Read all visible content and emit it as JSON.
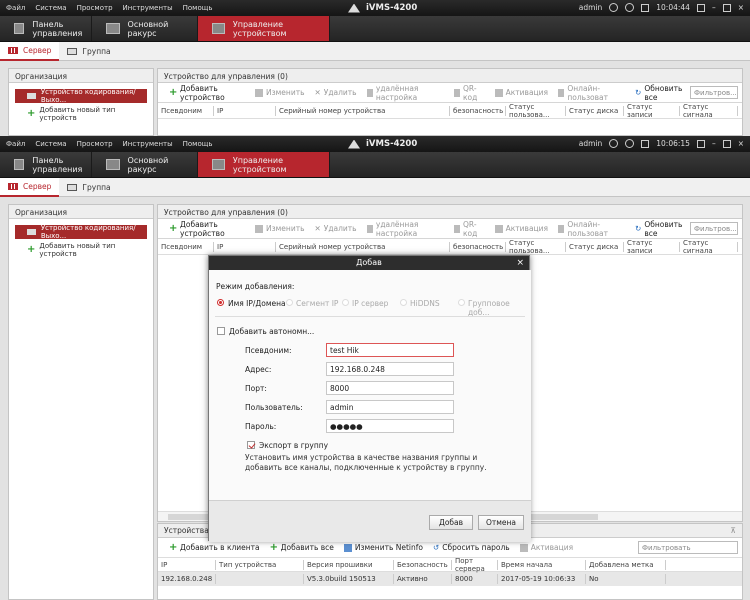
{
  "app": {
    "menu": [
      "Файл",
      "Система",
      "Просмотр",
      "Инструменты",
      "Помощь"
    ],
    "title": "iVMS-4200",
    "user": "admin",
    "nav_tabs": [
      "Панель управления",
      "Основной ракурс",
      "Управление устройством"
    ]
  },
  "window_back": {
    "time": "10:04:44"
  },
  "window_front": {
    "time": "10:06:15"
  },
  "subtabs": [
    "Сервер",
    "Группа"
  ],
  "left_panel": {
    "header": "Организация",
    "selected": "Устройство кодирования/Выхо...",
    "add_type": "Добавить новый тип устройств"
  },
  "devices_panel": {
    "header": "Устройство для управления (0)",
    "toolbar": {
      "add": "Добавить устройство",
      "modify": "Изменить",
      "delete": "Удалить",
      "remote": "удалённая настройка",
      "qr": "QR-код",
      "activate": "Активация",
      "online_user": "Онлайн-пользоват",
      "refresh": "Обновить все",
      "filter_placeholder": "Фильтров..."
    },
    "columns": [
      "Псевдоним",
      "IP",
      "Серийный номер устройства",
      "безопасность",
      "Статус пользова...",
      "Статус диска",
      "Статус записи",
      "Статус сигнала"
    ]
  },
  "online_panel": {
    "header": "Устройства Он",
    "toolbar": {
      "add_client": "Добавить в клиента",
      "add_all": "Добавить все",
      "modify_netinfo": "Изменить Netinfo",
      "reset_password": "Сбросить пароль",
      "activate": "Активация",
      "filter_placeholder": "Фильтровать"
    },
    "columns": [
      "IP",
      "Тип устройства",
      "Версия прошивки",
      "Безопасность",
      "Порт сервера",
      "Время начала",
      "Добавлена метка"
    ],
    "rows": [
      {
        "ip": "192.168.0.248",
        "type": "",
        "firmware": "V5.3.0build 150513",
        "security": "Активно",
        "port": "8000",
        "start": "2017-05-19 10:06:33",
        "added": "No"
      }
    ]
  },
  "dialog": {
    "title": "Добав",
    "close": "×",
    "mode_label": "Режим добавления:",
    "modes": [
      "Имя IP/Домена",
      "Сегмент IP",
      "IP сервер",
      "HiDDNS",
      "Групповое доб..."
    ],
    "offline_label": "Добавить автономн...",
    "fields": {
      "alias": {
        "label": "Псевдоним:",
        "value": "test Hik"
      },
      "address": {
        "label": "Адрес:",
        "value": "192.168.0.248"
      },
      "port": {
        "label": "Порт:",
        "value": "8000"
      },
      "user": {
        "label": "Пользователь:",
        "value": "admin"
      },
      "password": {
        "label": "Пароль:",
        "value": "●●●●●"
      }
    },
    "export_label": "Экспорт в группу",
    "hint_line1": "Установить имя устройства в качестве названия группы и",
    "hint_line2": "добавить все каналы, подключенные к устройству в группу.",
    "ok": "Добав",
    "cancel": "Отмена"
  }
}
